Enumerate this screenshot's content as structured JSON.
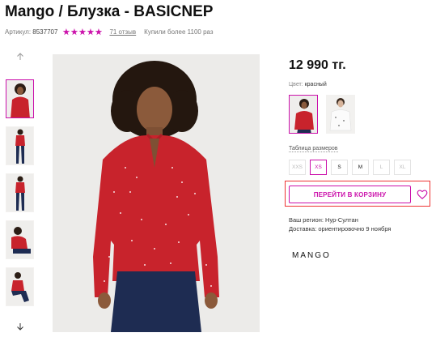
{
  "product": {
    "title": "Mango / Блузка - BASICNEP",
    "article_label": "Артикул:",
    "article_value": "8537707",
    "rating_stars": 5,
    "reviews": "71 отзыв",
    "purchases": "Купили более 1100 раз",
    "price": "12 990 тг.",
    "color_label": "Цвет:",
    "color_value": "красный",
    "size_table_link": "Таблица размеров",
    "sizes": [
      {
        "label": "XXS",
        "available": false,
        "selected": false
      },
      {
        "label": "XS",
        "available": true,
        "selected": true
      },
      {
        "label": "S",
        "available": true,
        "selected": false
      },
      {
        "label": "M",
        "available": true,
        "selected": false
      },
      {
        "label": "L",
        "available": false,
        "selected": false
      },
      {
        "label": "XL",
        "available": false,
        "selected": false
      }
    ],
    "cart_button": "ПЕРЕЙТИ В КОРЗИНУ",
    "region_label": "Ваш регион:",
    "region_value": "Нур-Султан",
    "delivery_label": "Доставка:",
    "delivery_value": "ориентировочно 9 ноября",
    "brand": "MANGO"
  },
  "icons": {
    "up": "arrow-up-icon",
    "down": "arrow-down-icon",
    "heart": "heart-icon",
    "star": "star-icon"
  },
  "colors": {
    "accent": "#cb11ab",
    "highlight_frame": "#ee3333",
    "blouse_red": "#c8232c",
    "jeans_blue": "#1e2c52"
  }
}
